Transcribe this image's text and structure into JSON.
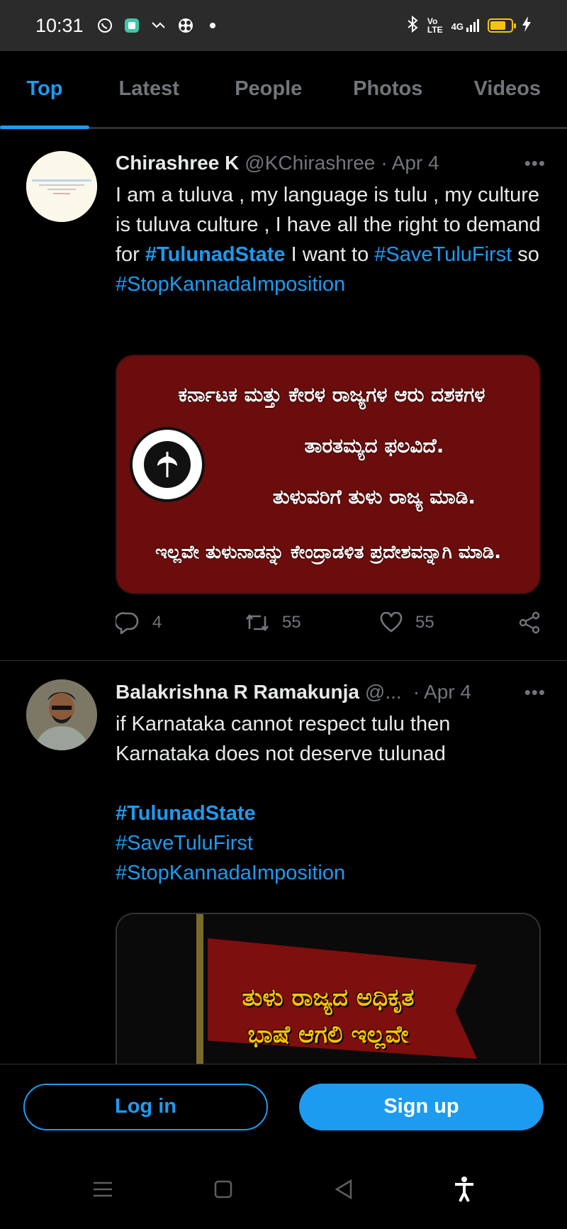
{
  "status_bar": {
    "time": "10:31",
    "left_icons": [
      "whatsapp-icon",
      "app-icon",
      "missed-call-icon",
      "pinwheel-icon",
      "dot-icon"
    ],
    "right_icons": [
      "bluetooth-icon",
      "volte-icon",
      "signal-4g-icon",
      "battery-icon",
      "charging-icon"
    ],
    "network": "4G",
    "battery_level": 0.75
  },
  "tabs": [
    {
      "label": "Top",
      "active": true
    },
    {
      "label": "Latest"
    },
    {
      "label": "People"
    },
    {
      "label": "Photos"
    },
    {
      "label": "Videos"
    }
  ],
  "tweets": [
    {
      "name": "Chirashree K",
      "handle": "@KChirashree",
      "sep": "·",
      "date": "Apr 4",
      "more": "•••",
      "text": {
        "l1": "I am a tuluva , my language is tulu , my culture is tuluva culture , I have all the right to demand for",
        "tag1": "#TulunadState",
        "l2": " I want to",
        "tag2": "#SaveTuluFirst",
        "l3": " so",
        "tag3": "#StopKannadaImposition"
      },
      "media_lines": [
        "ಕರ್ನಾಟಕ ಮತ್ತು ಕೇರಳ ರಾಜ್ಯಗಳ ಆರು ದಶಕಗಳ",
        "ತಾರತಮ್ಯದ ಫಲವಿದೆ.",
        "ತುಳುವರಿಗೆ ತುಳು ರಾಜ್ಯ ಮಾಡಿ.",
        "ಇಲ್ಲವೇ ತುಳುನಾಡನ್ನು ಕೇಂದ್ರಾಡಳಿತ ಪ್ರದೇಶವನ್ನಾಗಿ ಮಾಡಿ."
      ],
      "replies": "4",
      "retweets": "55",
      "likes": "55"
    },
    {
      "name": "Balakrishna R Ramakunja",
      "handle": "@...",
      "sep": "·",
      "date": "Apr 4",
      "more": "•••",
      "text": {
        "l1": "if Karnataka cannot respect tulu then Karnataka does not deserve tulunad",
        "tag1": "#TulunadState",
        "tag2": "#SaveTuluFirst",
        "tag3": "#StopKannadaImposition"
      },
      "media_lines": [
        "ತುಳು ರಾಜ್ಯದ ಅಧಿಕೃತ",
        "ಭಾಷೆ ಆಗಲಿ ಇಲ್ಲವೇ"
      ]
    }
  ],
  "bottom": {
    "login": "Log in",
    "signup": "Sign up"
  },
  "nav_icons": [
    "menu-icon",
    "home-square-icon",
    "back-triangle-icon",
    "accessibility-icon"
  ]
}
